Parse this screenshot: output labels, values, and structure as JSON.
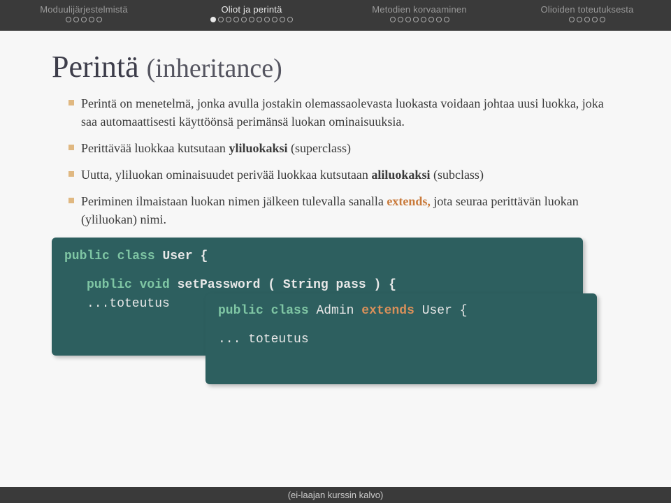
{
  "nav": {
    "sections": [
      {
        "label": "Moduulijärjestelmistä",
        "active": false,
        "dots": [
          0,
          0,
          0,
          0,
          0
        ]
      },
      {
        "label": "Oliot ja perintä",
        "active": true,
        "dots": [
          1,
          0,
          0,
          0,
          0,
          0,
          0,
          0,
          0,
          0,
          0
        ]
      },
      {
        "label": "Metodien korvaaminen",
        "active": false,
        "dots": [
          0,
          0,
          0,
          0,
          0,
          0,
          0,
          0
        ]
      },
      {
        "label": "Olioiden toteutuksesta",
        "active": false,
        "dots": [
          0,
          0,
          0,
          0,
          0
        ]
      }
    ]
  },
  "title": {
    "main": "Perintä",
    "sub": "(inheritance)"
  },
  "bullets": [
    {
      "text": "Perintä on menetelmä, jonka avulla jostakin olemassaolevasta luokasta voidaan johtaa uusi luokka, joka saa automaattisesti käyttöönsä perimänsä luokan ominaisuuksia."
    },
    {
      "pre": "Perittävää luokkaa kutsutaan ",
      "bold": "yliluokaksi",
      "post": " (superclass)"
    },
    {
      "pre": "Uutta, yliluokan ominaisuudet perivää luokkaa kutsutaan ",
      "bold": "aliluokaksi",
      "post": " (subclass)"
    },
    {
      "pre": "Periminen ilmaistaan luokan nimen jälkeen tulevalla sanalla ",
      "ext": "extends,",
      "post": " jota seuraa perittävän luokan (yliluokan) nimi."
    }
  ],
  "code1": {
    "l1a": "public class",
    "l1b": "User {",
    "l2a": "public void",
    "l2b": "setPassword ( String pass ) {",
    "l3": "...toteutus"
  },
  "code2": {
    "l1a": "public class",
    "l1b": "Admin",
    "l1ext": "extends",
    "l1c": "User {",
    "l2": "... toteutus"
  },
  "footer": "(ei-laajan kurssin kalvo)"
}
